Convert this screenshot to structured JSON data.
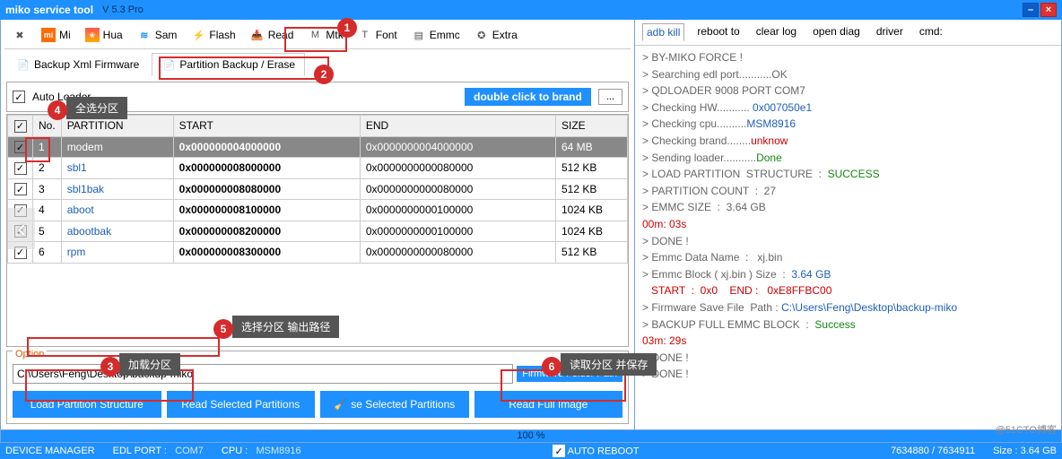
{
  "titlebar": {
    "title": "miko service tool",
    "version": "V 5.3 Pro"
  },
  "toolbar": [
    {
      "id": "wrench",
      "label": "",
      "icon": "✕"
    },
    {
      "id": "mi",
      "label": "Mi",
      "icon": "mi"
    },
    {
      "id": "hua",
      "label": "Hua",
      "icon": "❀"
    },
    {
      "id": "sam",
      "label": "Sam",
      "icon": "≋"
    },
    {
      "id": "flash",
      "label": "Flash",
      "icon": "⚡"
    },
    {
      "id": "read",
      "label": "Read",
      "icon": "📥"
    },
    {
      "id": "mtk",
      "label": "Mtk",
      "icon": "M"
    },
    {
      "id": "font",
      "label": "Font",
      "icon": "T"
    },
    {
      "id": "emmc",
      "label": "Emmc",
      "icon": "▤"
    },
    {
      "id": "extra",
      "label": "Extra",
      "icon": "✪"
    }
  ],
  "subtabs": {
    "backup_xml": "Backup Xml Firmware",
    "partition_be": "Partition Backup / Erase"
  },
  "loader": {
    "label": "Auto Loader",
    "brand_btn": "double click to brand",
    "browse": "..."
  },
  "table": {
    "headers": {
      "no": "No.",
      "partition": "PARTITION",
      "start": "START",
      "end": "END",
      "size": "SIZE"
    },
    "rows": [
      {
        "no": "1",
        "name": "modem",
        "start": "0x000000004000000",
        "end": "0x0000000004000000",
        "size": "64 MB",
        "sel": true
      },
      {
        "no": "2",
        "name": "sbl1",
        "start": "0x000000008000000",
        "end": "0x0000000000080000",
        "size": "512 KB",
        "sel": false
      },
      {
        "no": "3",
        "name": "sbl1bak",
        "start": "0x000000008080000",
        "end": "0x0000000000080000",
        "size": "512 KB",
        "sel": false
      },
      {
        "no": "4",
        "name": "aboot",
        "start": "0x000000008100000",
        "end": "0x0000000000100000",
        "size": "1024 KB",
        "sel": false
      },
      {
        "no": "5",
        "name": "abootbak",
        "start": "0x000000008200000",
        "end": "0x0000000000100000",
        "size": "1024 KB",
        "sel": false
      },
      {
        "no": "6",
        "name": "rpm",
        "start": "0x000000008300000",
        "end": "0x0000000000080000",
        "size": "512 KB",
        "sel": false
      }
    ]
  },
  "option": {
    "title": "Option",
    "path": "C:\\Users\\Feng\\Desktop\\backup-miko",
    "fw_folder": "Firmware Folder Path",
    "btn_load": "Load Partition Structure",
    "btn_read_sel": "Read Selected Partitions",
    "btn_erase_sel": "Erase Selected Partitions",
    "btn_read_full": "Read Full Image"
  },
  "right_tabs": [
    "adb kill",
    "reboot to",
    "clear log",
    "open diag",
    "driver",
    "cmd:"
  ],
  "log": [
    {
      "t": "> BY-MIKO FORCE !",
      "c": "gray"
    },
    {
      "t": "> Searching edl port...........OK",
      "c": "gray"
    },
    {
      "t": "> QDLOADER 9008 PORT COM7",
      "c": "gray"
    },
    {
      "t": "> Checking HW........... ",
      "c": "gray",
      "suffix": "0x007050e1",
      "sc": "blue"
    },
    {
      "t": "> Checking cpu..........",
      "c": "gray",
      "suffix": "MSM8916",
      "sc": "blue"
    },
    {
      "t": "> Checking brand........",
      "c": "gray",
      "suffix": "unknow",
      "sc": "red"
    },
    {
      "t": "> Sending loader...........",
      "c": "gray",
      "suffix": "Done",
      "sc": "green"
    },
    {
      "t": "> LOAD PARTITION  STRUCTURE  :  ",
      "c": "gray",
      "suffix": "SUCCESS",
      "sc": "green"
    },
    {
      "t": "> PARTITION COUNT  :  27",
      "c": "gray"
    },
    {
      "t": "> EMMC SIZE  :  3.64 GB",
      "c": "gray"
    },
    {
      "t": "00m: 03s",
      "c": "red"
    },
    {
      "t": "> DONE !",
      "c": "gray"
    },
    {
      "t": "> Emmc Data Name  :   xj.bin",
      "c": "gray"
    },
    {
      "t": "> Emmc Block ( xj.bin ) Size  :  ",
      "c": "gray",
      "suffix": "3.64 GB",
      "sc": "blue"
    },
    {
      "t": "   START  :  0x0    END :   0xE8FFBC00",
      "c": "red"
    },
    {
      "t": "> Firmware Save File  Path : ",
      "c": "gray",
      "suffix": "C:\\Users\\Feng\\Desktop\\backup-miko",
      "sc": "blue"
    },
    {
      "t": "> BACKUP FULL EMMC BLOCK  :  ",
      "c": "gray",
      "suffix": "Success",
      "sc": "green"
    },
    {
      "t": "03m: 29s",
      "c": "red"
    },
    {
      "t": "> DONE !",
      "c": "gray"
    },
    {
      "t": "> DONE !",
      "c": "gray"
    }
  ],
  "progress": "100  %",
  "status": {
    "dm": "DEVICE MANAGER",
    "edl": "EDL PORT :",
    "edl_val": "COM7",
    "cpu": "CPU :",
    "cpu_val": "MSM8916",
    "auto": "AUTO REBOOT",
    "nums": "7634880   /   7634911",
    "size": "Size : 3.64 GB"
  },
  "callouts": {
    "h4": "全选分区",
    "h5": "选择分区 输出路径",
    "h3": "加载分区",
    "h6": "读取分区 并保存"
  },
  "watermark": "@51CTO博客"
}
